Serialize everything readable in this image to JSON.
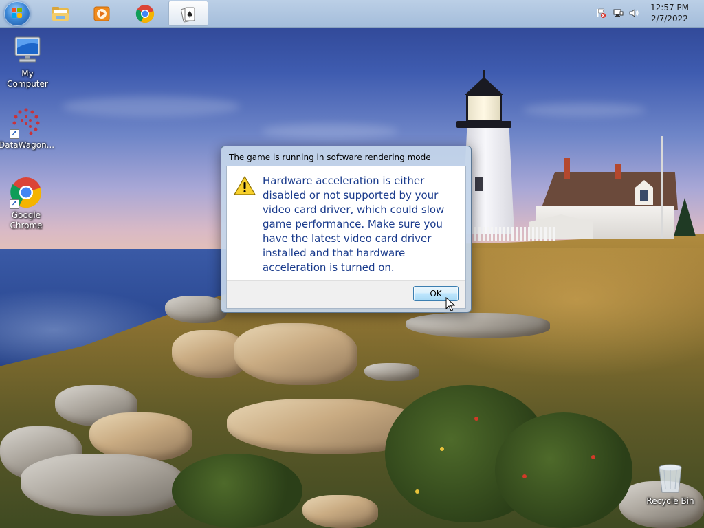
{
  "taskbar": {
    "apps": [
      {
        "name": "File Explorer"
      },
      {
        "name": "Windows Media Player"
      },
      {
        "name": "Google Chrome"
      },
      {
        "name": "Solitaire",
        "active": true
      }
    ],
    "clock": {
      "time": "12:57 PM",
      "date": "2/7/2022"
    },
    "tray_icons": [
      "action-center-flag-icon",
      "network-icon",
      "volume-icon"
    ]
  },
  "desktop": {
    "icons": [
      {
        "label": "My Computer",
        "icon": "computer-icon"
      },
      {
        "label": "DataWagon...",
        "icon": "datawagon-icon",
        "shortcut": true
      },
      {
        "label": "Google Chrome",
        "icon": "chrome-icon",
        "shortcut": true
      },
      {
        "label": "Recycle Bin",
        "icon": "recycle-bin-icon"
      }
    ]
  },
  "dialog": {
    "title": "The game is running in software rendering mode",
    "message": "Hardware acceleration is either disabled or not supported by your video card driver, which could slow game performance. Make sure you have the latest video card driver installed and that hardware acceleration is turned on.",
    "ok_label": "OK",
    "icon": "warning-icon"
  },
  "colors": {
    "message_text": "#1a3b8c",
    "taskbar": "#b5cbe2",
    "button_border": "#3c7fb1"
  }
}
